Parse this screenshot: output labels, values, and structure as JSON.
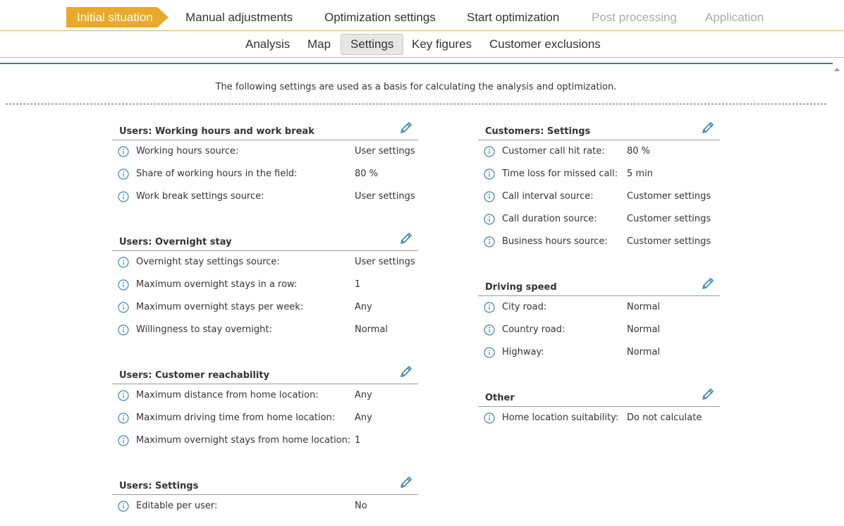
{
  "steps": [
    {
      "label": "Initial situation",
      "state": "active"
    },
    {
      "label": "Manual adjustments",
      "state": "enabled"
    },
    {
      "label": "Optimization settings",
      "state": "enabled"
    },
    {
      "label": "Start optimization",
      "state": "enabled"
    },
    {
      "label": "Post processing",
      "state": "disabled"
    },
    {
      "label": "Application",
      "state": "disabled"
    }
  ],
  "tabs": [
    {
      "label": "Analysis"
    },
    {
      "label": "Map"
    },
    {
      "label": "Settings",
      "selected": true
    },
    {
      "label": "Key figures"
    },
    {
      "label": "Customer exclusions"
    }
  ],
  "intro": "The following settings are used as a basis for calculating the analysis and optimization.",
  "colors": {
    "accent": "#e9a92a",
    "link": "#2f7fae",
    "icon": "#3a86b5"
  },
  "icons": {
    "info": "info-icon",
    "edit": "pencil-icon"
  },
  "sections": {
    "working_hours": {
      "title": "Users: Working hours and work break",
      "rows": [
        {
          "label": "Working hours source:",
          "value": "User settings"
        },
        {
          "label": "Share of working hours in the field:",
          "value": "80 %"
        },
        {
          "label": "Work break settings source:",
          "value": "User settings"
        }
      ]
    },
    "overnight": {
      "title": "Users: Overnight stay",
      "rows": [
        {
          "label": "Overnight stay settings source:",
          "value": "User settings"
        },
        {
          "label": "Maximum overnight stays in a row:",
          "value": "1"
        },
        {
          "label": "Maximum overnight stays per week:",
          "value": "Any"
        },
        {
          "label": "Willingness to stay overnight:",
          "value": "Normal"
        }
      ]
    },
    "reachability": {
      "title": "Users: Customer reachability",
      "rows": [
        {
          "label": "Maximum distance from home location:",
          "value": "Any"
        },
        {
          "label": "Maximum driving time from home location:",
          "value": "Any"
        },
        {
          "label": "Maximum overnight stays from home location:",
          "value": "1"
        }
      ]
    },
    "user_settings": {
      "title": "Users: Settings",
      "rows": [
        {
          "label": "Editable per user:",
          "value": "No"
        }
      ]
    },
    "customers": {
      "title": "Customers: Settings",
      "rows": [
        {
          "label": "Customer call hit rate:",
          "value": "80 %"
        },
        {
          "label": "Time loss for missed call:",
          "value": "5 min"
        },
        {
          "label": "Call interval source:",
          "value": "Customer settings"
        },
        {
          "label": "Call duration source:",
          "value": "Customer settings"
        },
        {
          "label": "Business hours source:",
          "value": "Customer settings"
        }
      ]
    },
    "driving": {
      "title": "Driving speed",
      "rows": [
        {
          "label": "City road:",
          "value": "Normal"
        },
        {
          "label": "Country road:",
          "value": "Normal"
        },
        {
          "label": "Highway:",
          "value": "Normal"
        }
      ]
    },
    "other": {
      "title": "Other",
      "rows": [
        {
          "label": "Home location suitability:",
          "value": "Do not calculate"
        }
      ]
    }
  }
}
